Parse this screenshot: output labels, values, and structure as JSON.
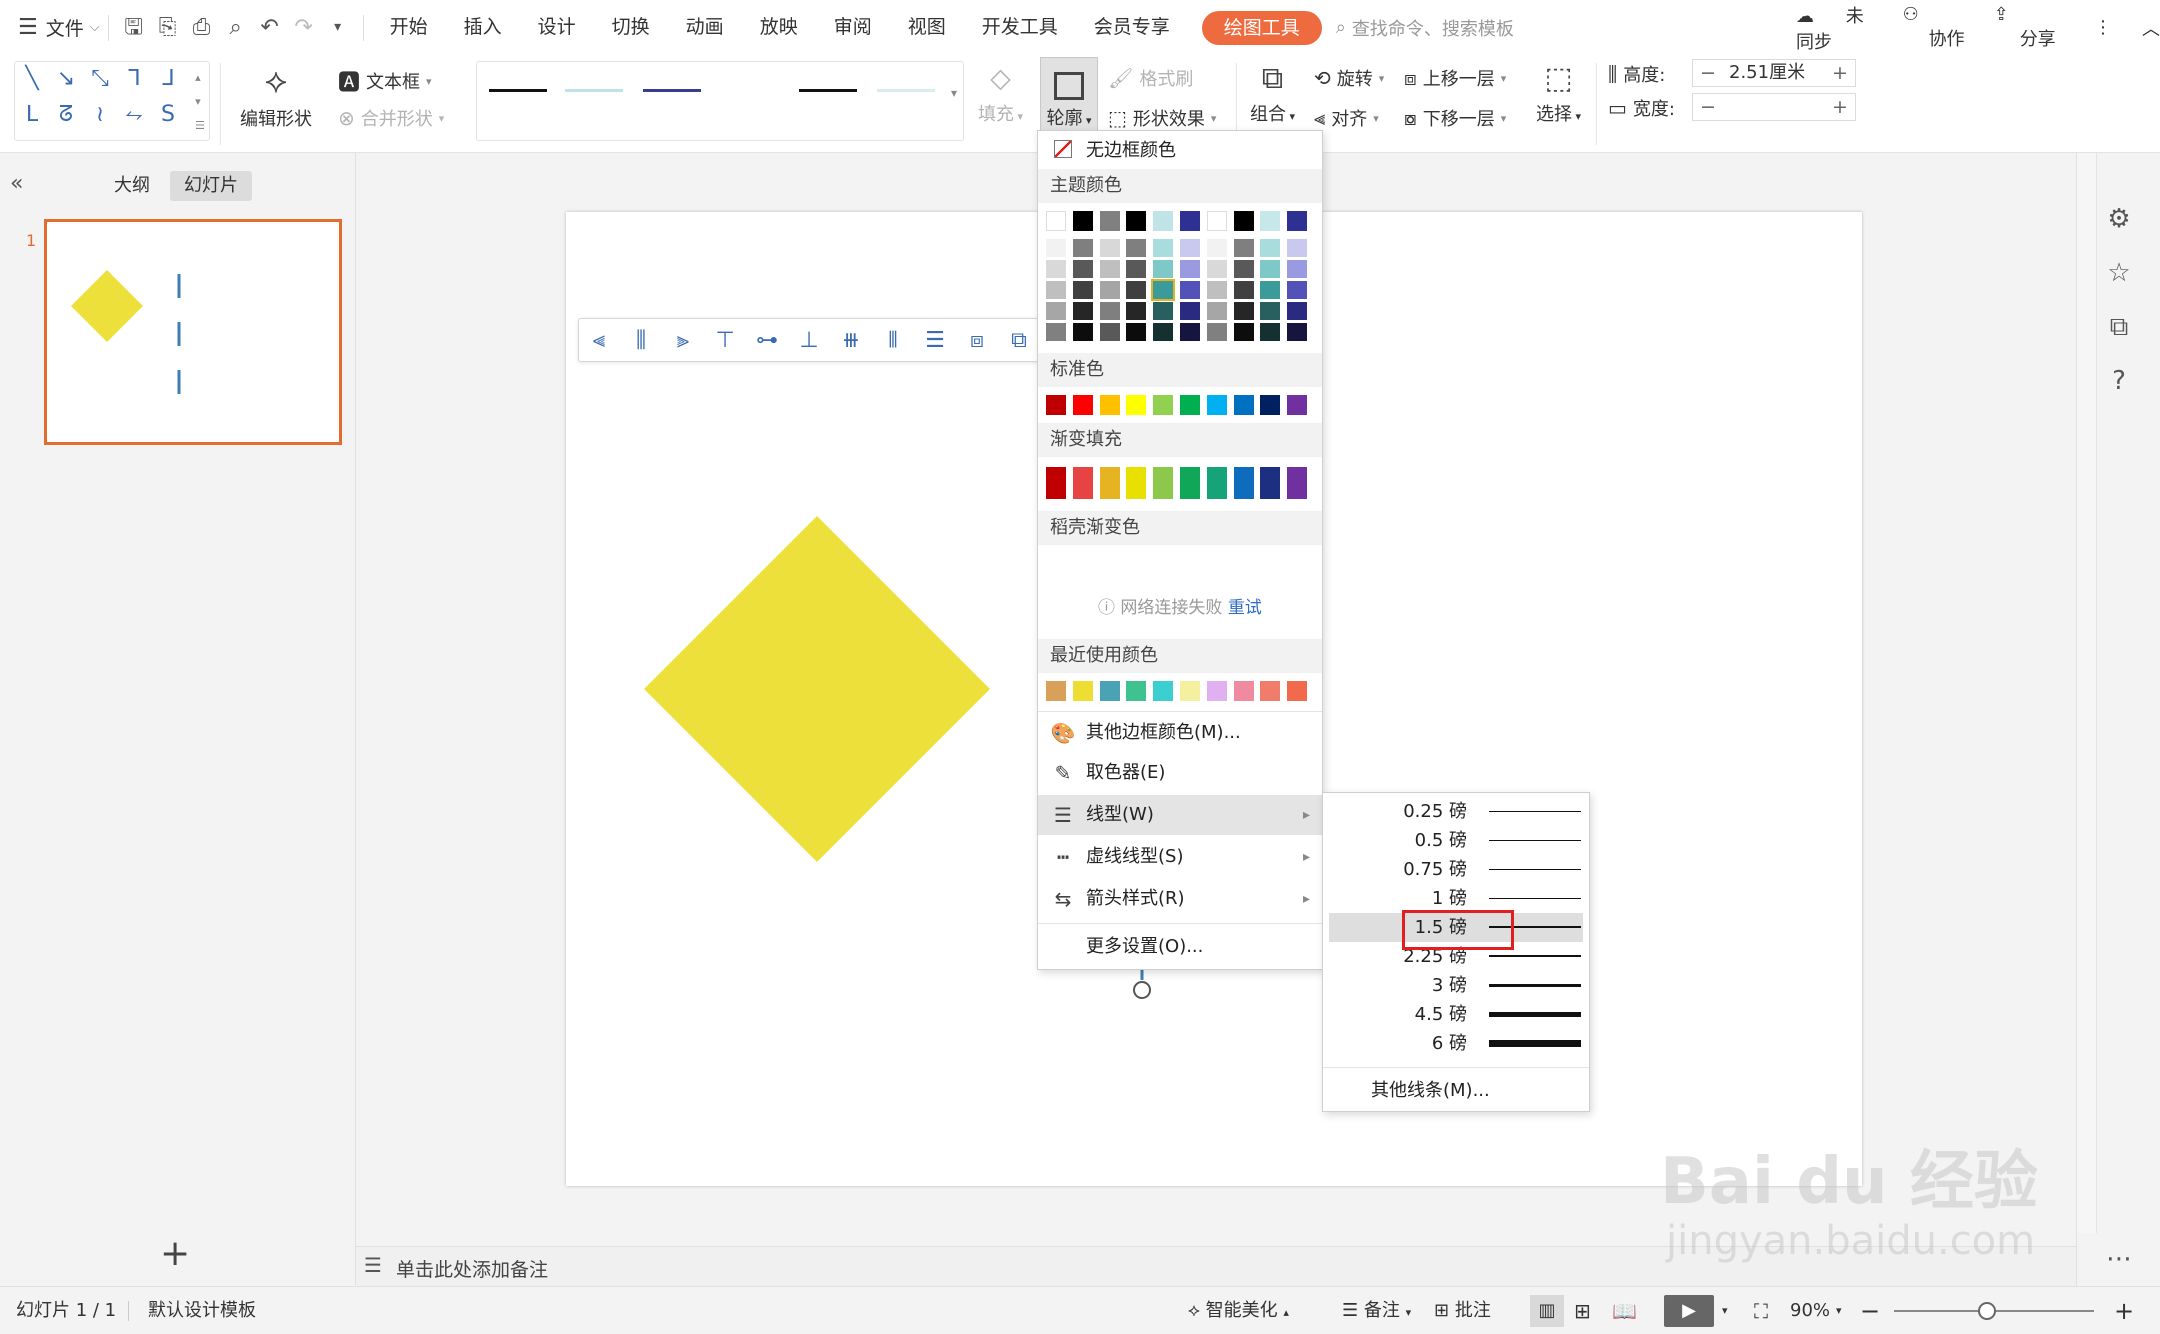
{
  "menubar": {
    "file": "文件",
    "tabs": [
      "开始",
      "插入",
      "设计",
      "切换",
      "动画",
      "放映",
      "审阅",
      "视图",
      "开发工具",
      "会员专享"
    ],
    "active_tab": "绘图工具",
    "search_placeholder": "查找命令、搜索模板",
    "sync": "未同步",
    "collab": "协作",
    "share": "分享"
  },
  "ribbon": {
    "edit_shape": "编辑形状",
    "textbox": "文本框",
    "merge_shape": "合并形状",
    "fill": "填充",
    "outline": "轮廓",
    "format_painter": "格式刷",
    "shape_effect": "形状效果",
    "group": "组合",
    "rotate": "旋转",
    "align": "对齐",
    "bring_forward": "上移一层",
    "send_backward": "下移一层",
    "select": "选择",
    "height_label": "高度:",
    "height_value": "2.51厘米",
    "width_label": "宽度:",
    "width_value": "",
    "minus": "−",
    "plus": "+"
  },
  "leftpanel": {
    "tab_outline": "大纲",
    "tab_slides": "幻灯片",
    "slide_number": "1",
    "add_symbol": "+"
  },
  "outline_menu": {
    "no_border": "无边框颜色",
    "theme_colors": "主题颜色",
    "standard_colors": "标准色",
    "gradient_fill": "渐变填充",
    "daoke_gradient": "稻壳渐变色",
    "network_failed": "网络连接失败",
    "retry": "重试",
    "recent_colors": "最近使用颜色",
    "more_border_colors": "其他边框颜色(M)...",
    "eyedropper": "取色器(E)",
    "line_style": "线型(W)",
    "dash_style": "虚线线型(S)",
    "arrow_style": "箭头样式(R)",
    "more_settings": "更多设置(O)...",
    "theme_top_row": [
      "#ffffff",
      "#000000",
      "#808080",
      "#000000",
      "#bfe3e6",
      "#2f3192",
      "#ffffff",
      "#000000",
      "#c7e8e9",
      "#2e3192"
    ],
    "standard": [
      "#c00000",
      "#ff0000",
      "#ffc000",
      "#ffff00",
      "#92d050",
      "#00b050",
      "#00b0f0",
      "#0070c0",
      "#002060",
      "#7030a0"
    ],
    "gradient": [
      "#c00000",
      "#e84343",
      "#e6b422",
      "#e8e000",
      "#8cc84b",
      "#10a858",
      "#16a37a",
      "#0f6cbd",
      "#1c2f80",
      "#7030a0"
    ],
    "recent": [
      "#d9a05b",
      "#eedd33",
      "#4aa3b5",
      "#3ec28f",
      "#3ccfcf",
      "#f5f0a0",
      "#e0b0f0",
      "#f08aa0",
      "#f07c6c",
      "#f26a4b"
    ]
  },
  "weight_menu": {
    "items": [
      "0.25 磅",
      "0.5 磅",
      "0.75 磅",
      "1 磅",
      "1.5 磅",
      "2.25 磅",
      "3 磅",
      "4.5 磅",
      "6 磅"
    ],
    "selected": "1.5 磅",
    "more_lines": "其他线条(M)..."
  },
  "notes": {
    "placeholder": "单击此处添加备注"
  },
  "statusbar": {
    "slide_info": "幻灯片 1 / 1",
    "template": "默认设计模板",
    "smart_beautify": "智能美化",
    "notes": "备注",
    "comment": "批注",
    "zoom": "90%"
  },
  "colors": {
    "diamond": "#ede03a",
    "accent": "#ee6a3f",
    "thumb_border": "#e36c2f",
    "highlight_box": "#e02020"
  },
  "watermark": {
    "brand": "Bai du 经验",
    "url": "jingyan.baidu.com"
  }
}
